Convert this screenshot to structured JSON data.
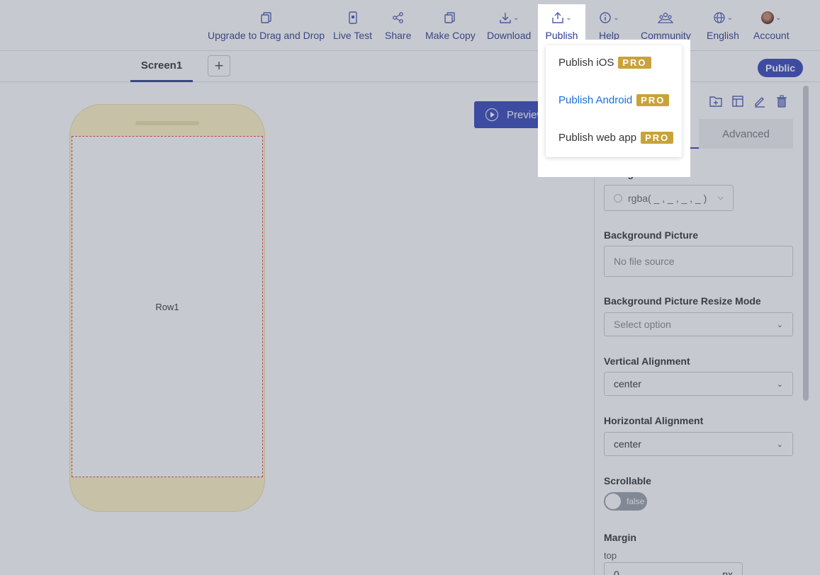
{
  "toolbar": {
    "items": [
      {
        "label": "Upgrade to Drag and Drop",
        "icon": "copy-icon"
      },
      {
        "label": "Live Test",
        "icon": "phone-icon"
      },
      {
        "label": "Share",
        "icon": "share-icon"
      },
      {
        "label": "Make Copy",
        "icon": "copy-icon"
      },
      {
        "label": "Download",
        "icon": "download-icon"
      },
      {
        "label": "Publish",
        "icon": "upload-icon"
      },
      {
        "label": "Help",
        "icon": "info-icon"
      },
      {
        "label": "Community",
        "icon": "people-icon"
      },
      {
        "label": "English",
        "icon": "globe-icon"
      },
      {
        "label": "Account",
        "icon": "avatar"
      }
    ]
  },
  "tabs": {
    "active": "Screen1",
    "add_label": "+"
  },
  "visibility_badge": "Public",
  "canvas": {
    "preview_label": "Preview",
    "row_label": "Row1"
  },
  "publish_menu": {
    "items": [
      {
        "label": "Publish iOS",
        "badge": "PRO",
        "active": false
      },
      {
        "label": "Publish Android",
        "badge": "PRO",
        "active": true
      },
      {
        "label": "Publish web app",
        "badge": "PRO",
        "active": false
      }
    ]
  },
  "properties": {
    "advanced_tab": "Advanced",
    "background_color": {
      "label": "BackgroundColor",
      "value": "rgba( _ , _ , _ , _ )"
    },
    "background_picture": {
      "label": "Background Picture",
      "placeholder": "No file source"
    },
    "resize_mode": {
      "label": "Background Picture Resize Mode",
      "placeholder": "Select option"
    },
    "vertical_alignment": {
      "label": "Vertical Alignment",
      "value": "center"
    },
    "horizontal_alignment": {
      "label": "Horizontal Alignment",
      "value": "center"
    },
    "scrollable": {
      "label": "Scrollable",
      "value": "false"
    },
    "margin": {
      "label": "Margin",
      "sub_label": "top",
      "value": "0",
      "unit": "px"
    }
  },
  "colors": {
    "accent": "#3446b8",
    "pro_badge": "#c9a23a",
    "active_link": "#1b6fd6",
    "phone_frame": "#fff3c4"
  }
}
